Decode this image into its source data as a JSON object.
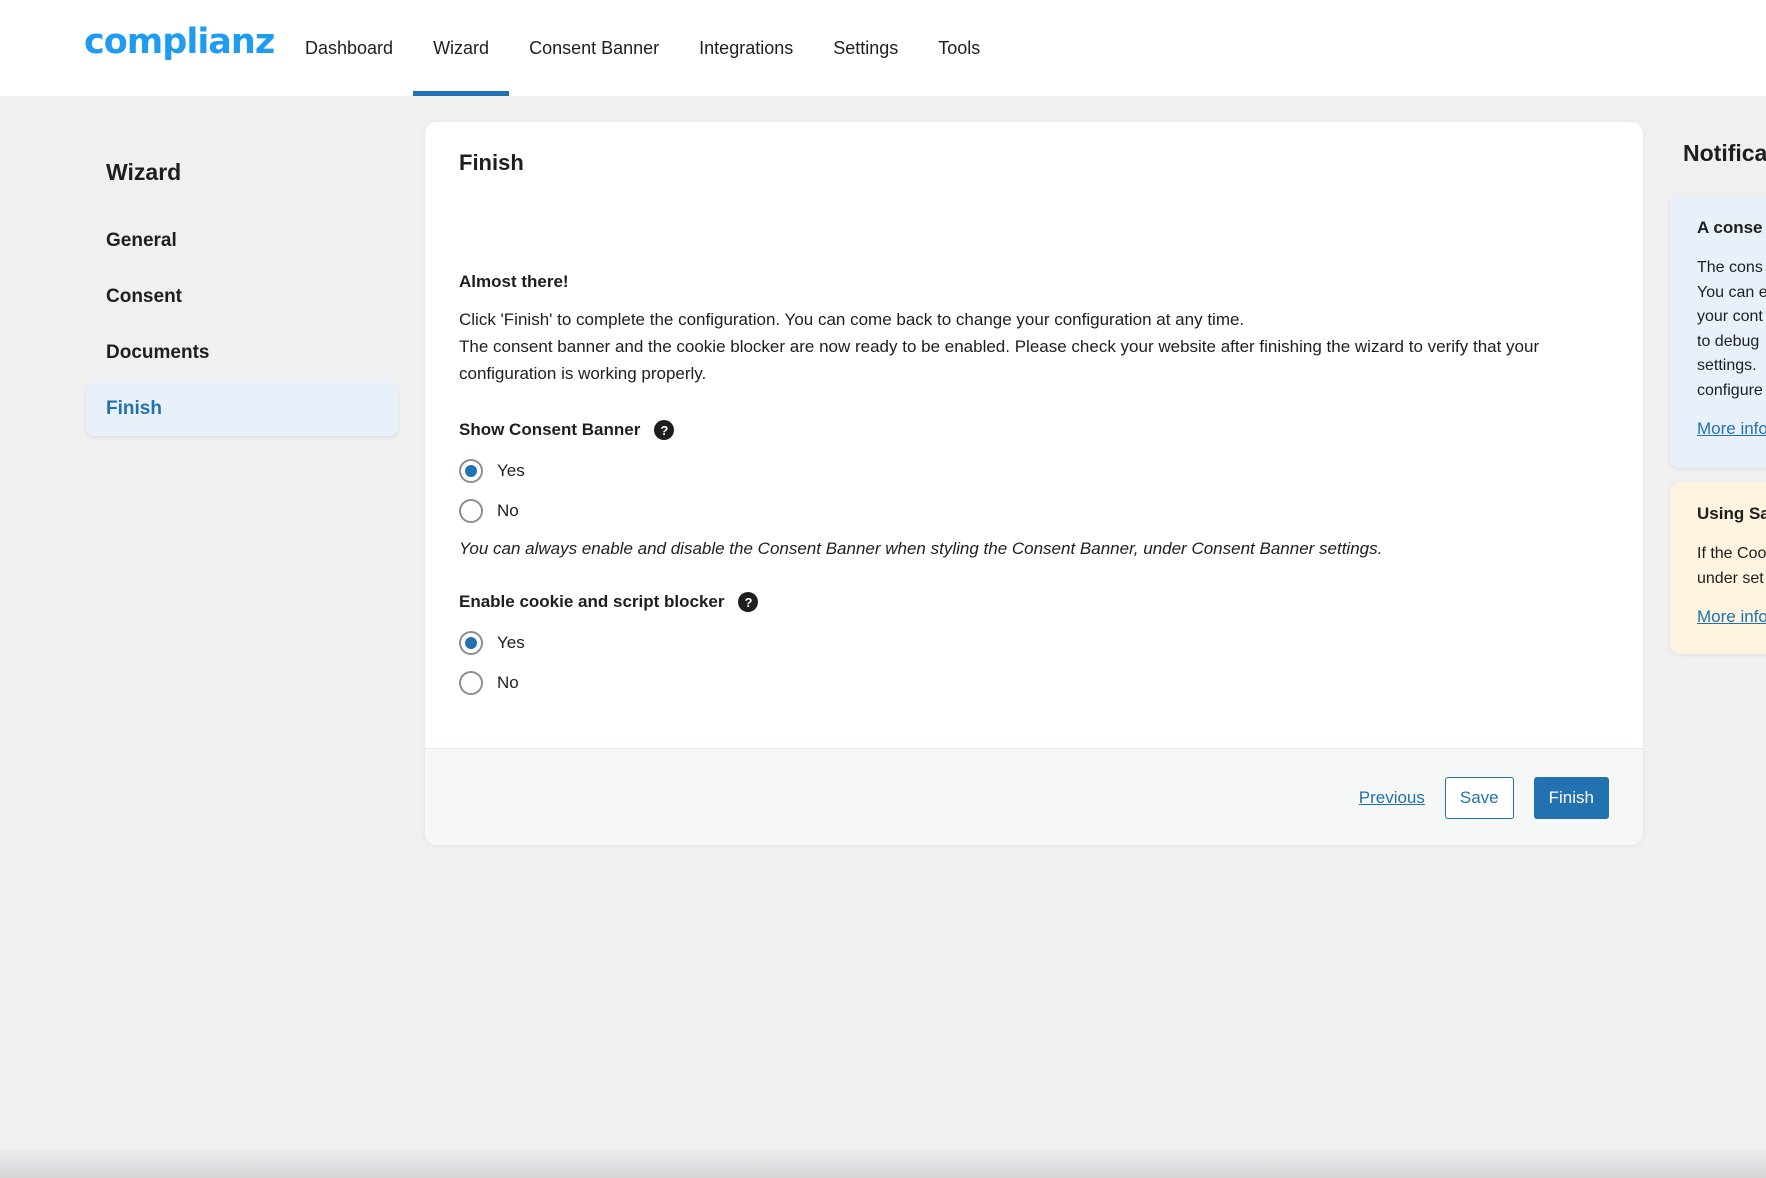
{
  "header": {
    "logo": "complianz",
    "nav": [
      {
        "label": "Dashboard"
      },
      {
        "label": "Wizard"
      },
      {
        "label": "Consent Banner"
      },
      {
        "label": "Integrations"
      },
      {
        "label": "Settings"
      },
      {
        "label": "Tools"
      }
    ],
    "active_nav": "Wizard"
  },
  "sidebar": {
    "title": "Wizard",
    "items": [
      {
        "label": "General"
      },
      {
        "label": "Consent"
      },
      {
        "label": "Documents"
      },
      {
        "label": "Finish"
      }
    ],
    "active_item": "Finish"
  },
  "main": {
    "title": "Finish",
    "intro_heading": "Almost there!",
    "intro_line1": "Click 'Finish' to complete the configuration. You can come back to change your configuration at any time.",
    "intro_line2": "The consent banner and the cookie blocker are now ready to be enabled. Please check your website after finishing the wizard to verify that your configuration is working properly.",
    "help_glyph": "?",
    "fields": [
      {
        "label": "Show Consent Banner",
        "options": [
          "Yes",
          "No"
        ],
        "selected": "Yes",
        "note": "You can always enable and disable the Consent Banner when styling the Consent Banner, under Consent Banner settings."
      },
      {
        "label": "Enable cookie and script blocker",
        "options": [
          "Yes",
          "No"
        ],
        "selected": "Yes"
      }
    ],
    "footer": {
      "previous_label": "Previous",
      "save_label": "Save",
      "finish_label": "Finish"
    }
  },
  "notifications": {
    "title": "Notifica",
    "cards": [
      {
        "heading": "A conse",
        "lines": [
          "The cons",
          "You can e",
          "your cont",
          "to debug",
          "settings.",
          "configure"
        ],
        "more": "More info"
      },
      {
        "heading": "Using Sa",
        "lines": [
          "If the Coo",
          "under set"
        ],
        "more": "More info"
      }
    ]
  },
  "colors": {
    "accent": "#2271b1",
    "logo": "#1f9cf0",
    "background": "#f0f0f1",
    "active_sidebar_bg": "#e8f1fa",
    "notice_blue": "#e8f1fa",
    "notice_yellow": "#fdf4e0"
  },
  "icons": {
    "help": "question-circle-icon",
    "radio_checked": "radio-checked-icon",
    "radio_unchecked": "radio-unchecked-icon"
  }
}
